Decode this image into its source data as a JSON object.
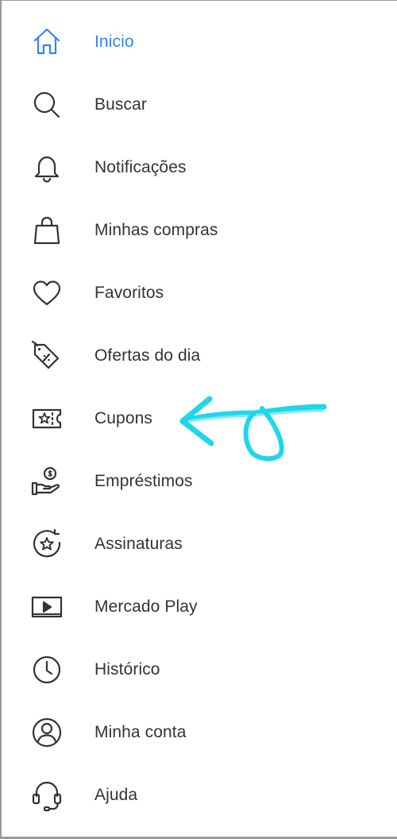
{
  "menu": {
    "items": [
      {
        "label": "Inicio",
        "icon": "home-icon",
        "active": true
      },
      {
        "label": "Buscar",
        "icon": "search-icon"
      },
      {
        "label": "Notificações",
        "icon": "bell-icon"
      },
      {
        "label": "Minhas compras",
        "icon": "shopping-bag-icon"
      },
      {
        "label": "Favoritos",
        "icon": "heart-icon"
      },
      {
        "label": "Ofertas do dia",
        "icon": "discount-tag-icon"
      },
      {
        "label": "Cupons",
        "icon": "coupon-ticket-icon"
      },
      {
        "label": "Empréstimos",
        "icon": "loan-hand-coin-icon"
      },
      {
        "label": "Assinaturas",
        "icon": "subscription-star-icon"
      },
      {
        "label": "Mercado Play",
        "icon": "play-screen-icon"
      },
      {
        "label": "Histórico",
        "icon": "clock-icon"
      },
      {
        "label": "Minha conta",
        "icon": "user-account-icon"
      },
      {
        "label": "Ajuda",
        "icon": "headset-icon"
      }
    ]
  },
  "colors": {
    "active": "#3483fa",
    "text": "#333333",
    "icon": "#333333",
    "annotation_arrow": "#1fd6ea"
  },
  "annotation": {
    "type": "hand-drawn arrow",
    "points_to": "Cupons"
  }
}
